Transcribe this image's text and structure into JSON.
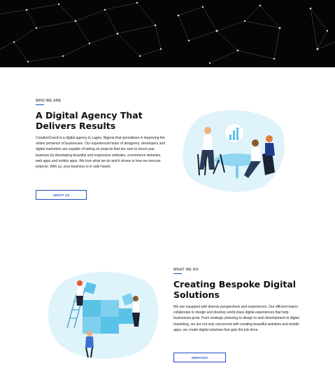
{
  "hero": {
    "background": "#050505"
  },
  "about": {
    "eyebrow": "WHO WE ARE",
    "title_line1": "A Digital Agency That",
    "title_line2": "Delivers Results",
    "body": "CreationCreed is a digital agency in Lagos, Nigeria that specializes in improving the online presence of businesses. Our experienced team of designers, developers and digital marketers are capable of taking on projects that are sure to boost your business by developing beautiful and responsive websites, ecommerce websites, web apps and mobile apps. We love what we do and it shows in how we execute projects. With us, your business is in safe hands.",
    "button": "ABOUT US",
    "illustration_icon": "team-meeting-illustration"
  },
  "services": {
    "eyebrow": "WHAT WE DO",
    "title_line1": "Creating Bespoke Digital",
    "title_line2": "Solutions",
    "body": "We are equipped with diverse perspectives and experiences. Our efficient teams collaborate to design and develop world-class digital experiences that help businesses grow. From strategic planning to design to web development to digital marketing, we are not only concerned with creating beautiful websites and mobile apps, we create digital solutions that gets the job done.",
    "button": "SERVICES",
    "illustration_icon": "puzzle-team-illustration"
  },
  "colors": {
    "accent": "#1e4fc2",
    "blob": "#dff3fb",
    "illustration": "#5bc2e7"
  }
}
